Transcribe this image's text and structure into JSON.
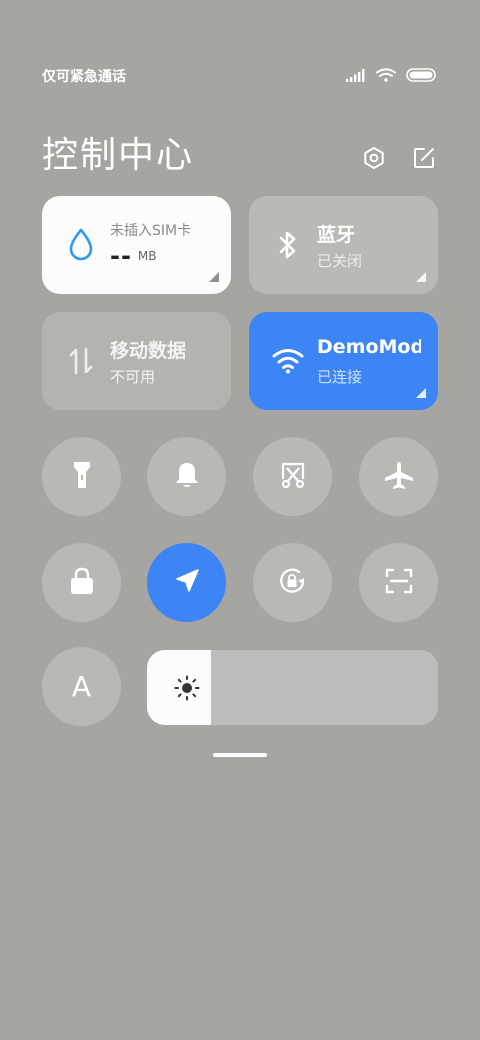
{
  "status_bar": {
    "carrier": "仅可紧急通话",
    "icons": [
      "signal-icon",
      "wifi-icon",
      "battery-icon"
    ]
  },
  "header": {
    "title": "控制中心",
    "actions": [
      "settings-icon",
      "edit-icon"
    ]
  },
  "tiles": {
    "data_usage": {
      "line1": "未插入SIM卡",
      "value": "--",
      "unit": "MB",
      "icon": "water-drop-icon"
    },
    "bluetooth": {
      "label": "蓝牙",
      "status": "已关闭",
      "icon": "bluetooth-icon"
    },
    "mobile_data": {
      "label": "移动数据",
      "status": "不可用",
      "icon": "data-arrows-icon"
    },
    "wifi": {
      "label": "DemoMode",
      "status": "已连接",
      "icon": "wifi-icon"
    }
  },
  "toggles_row1": [
    "flashlight-icon",
    "bell-icon",
    "screenshot-icon",
    "airplane-icon"
  ],
  "toggles_row2": [
    "lock-icon",
    "location-icon",
    "rotation-lock-icon",
    "scan-icon"
  ],
  "font_toggle": {
    "label": "A"
  },
  "brightness": {
    "level": 0.22,
    "icon": "sun-icon"
  },
  "colors": {
    "accent": "#3d85f5",
    "background": "#a6a5a1"
  }
}
